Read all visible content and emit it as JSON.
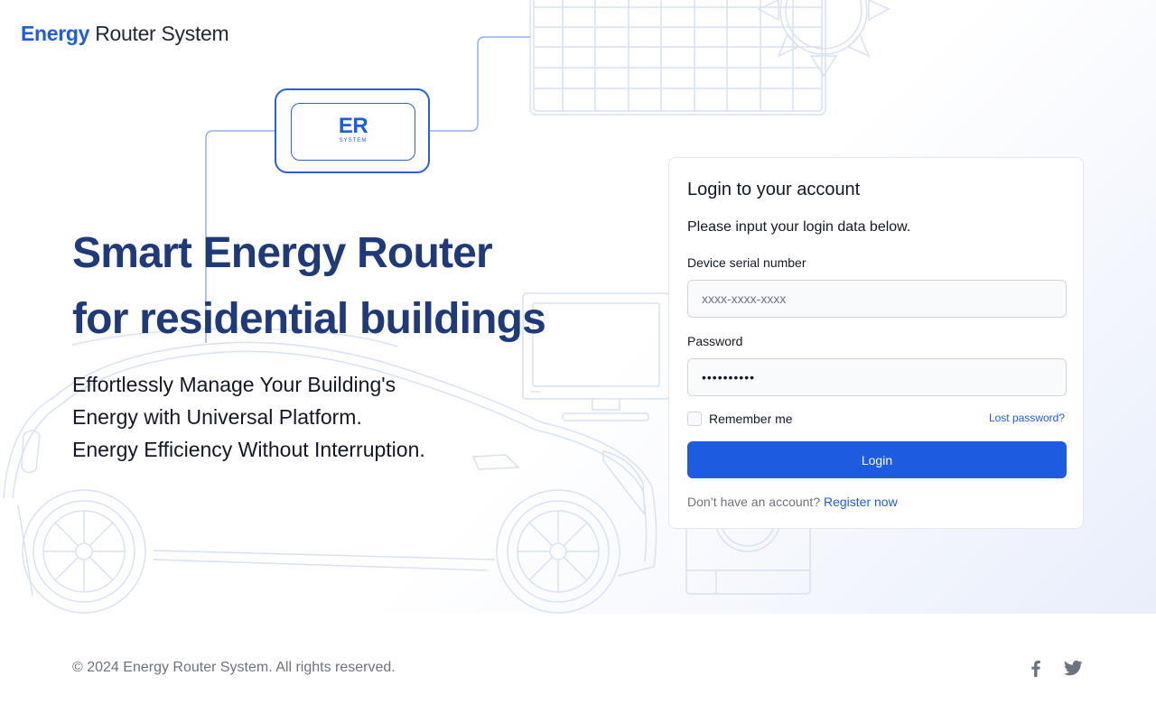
{
  "brand": {
    "strong": "Energy",
    "light": "Router System"
  },
  "badge": {
    "text": "ER",
    "sub": "SYSTEM"
  },
  "hero": {
    "headline": [
      "Smart Energy Router",
      "for residential buildings"
    ],
    "subtext": [
      "Effortlessly Manage Your Building's",
      "Energy with Universal Platform.",
      "Energy Efficiency Without Interruption."
    ]
  },
  "login": {
    "title": "Login to your account",
    "description": "Please input your login data below.",
    "serial_label": "Device serial number",
    "serial_placeholder": "xxxx-xxxx-xxxx",
    "password_label": "Password",
    "password_value": "••••••••••",
    "remember_label": "Remember me",
    "lost_password": "Lost password?",
    "button_label": "Login",
    "no_account": "Don’t have an account?",
    "register_link": "Register now"
  },
  "footer": {
    "copyright": "© 2024 Energy Router System. All rights reserved.",
    "social": [
      "facebook-icon",
      "twitter-icon"
    ]
  },
  "colors": {
    "accent": "#1d5ce0",
    "headline": "#1e3a78",
    "line_art": "#d8e2f4",
    "muted_text": "#6b7280"
  }
}
